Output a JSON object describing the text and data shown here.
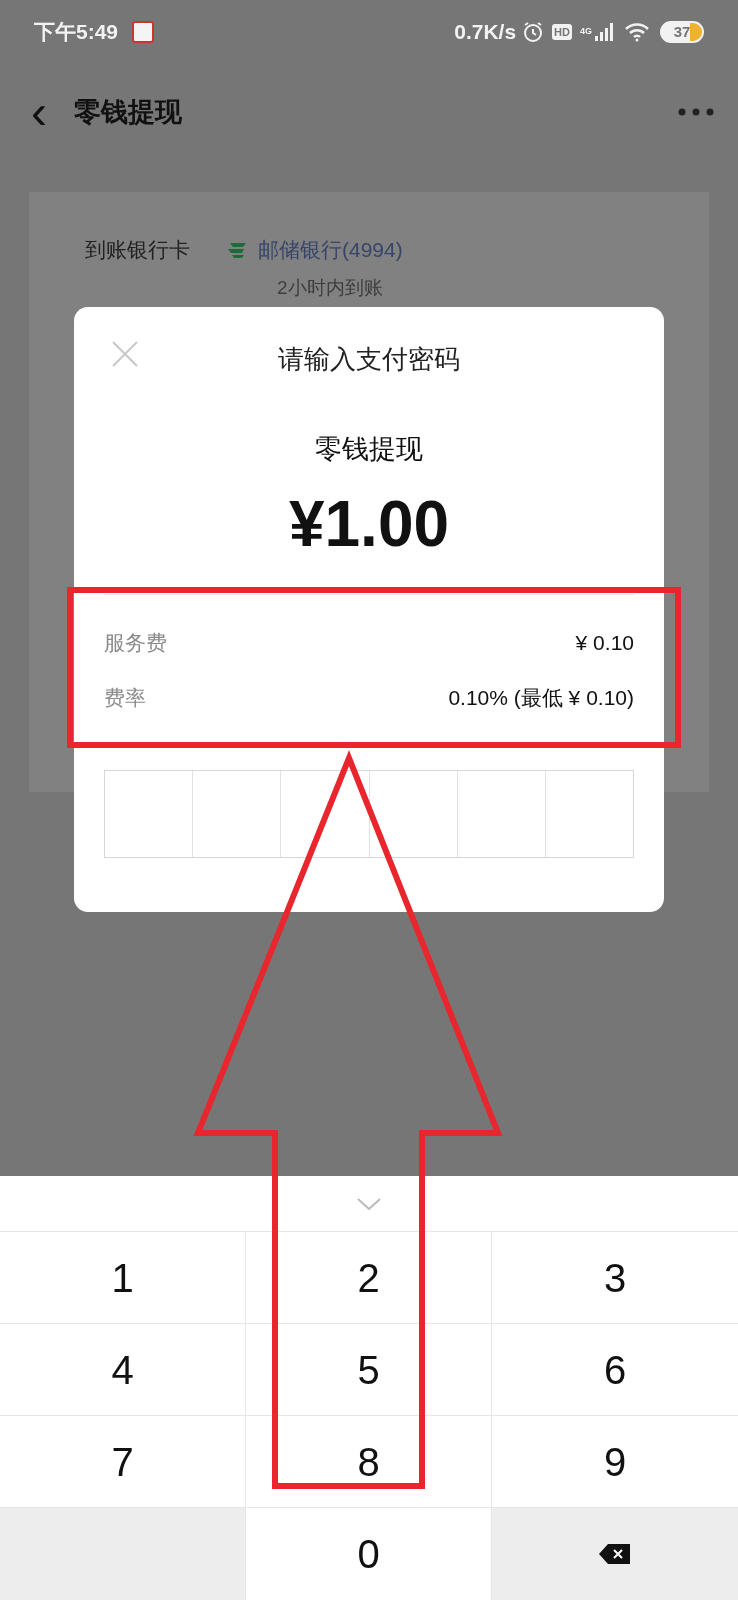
{
  "status_bar": {
    "time": "下午5:49",
    "speed": "0.7K/s",
    "hd": "HD",
    "network": "4G",
    "battery": "37"
  },
  "header": {
    "back": "‹",
    "title": "零钱提现"
  },
  "card": {
    "label": "到账银行卡",
    "bank": "邮储银行(4994)",
    "note": "2小时内到账"
  },
  "dialog": {
    "title": "请输入支付密码",
    "subtitle": "零钱提现",
    "amount": "¥1.00",
    "rows": [
      {
        "label": "服务费",
        "value": "¥ 0.10"
      },
      {
        "label": "费率",
        "value": "0.10% (最低 ¥ 0.10)"
      }
    ]
  },
  "keypad": [
    {
      "kind": "digit",
      "label": "1"
    },
    {
      "kind": "digit",
      "label": "2"
    },
    {
      "kind": "digit",
      "label": "3"
    },
    {
      "kind": "digit",
      "label": "4"
    },
    {
      "kind": "digit",
      "label": "5"
    },
    {
      "kind": "digit",
      "label": "6"
    },
    {
      "kind": "digit",
      "label": "7"
    },
    {
      "kind": "digit",
      "label": "8"
    },
    {
      "kind": "digit",
      "label": "9"
    },
    {
      "kind": "blank"
    },
    {
      "kind": "digit",
      "label": "0"
    },
    {
      "kind": "backspace"
    }
  ]
}
